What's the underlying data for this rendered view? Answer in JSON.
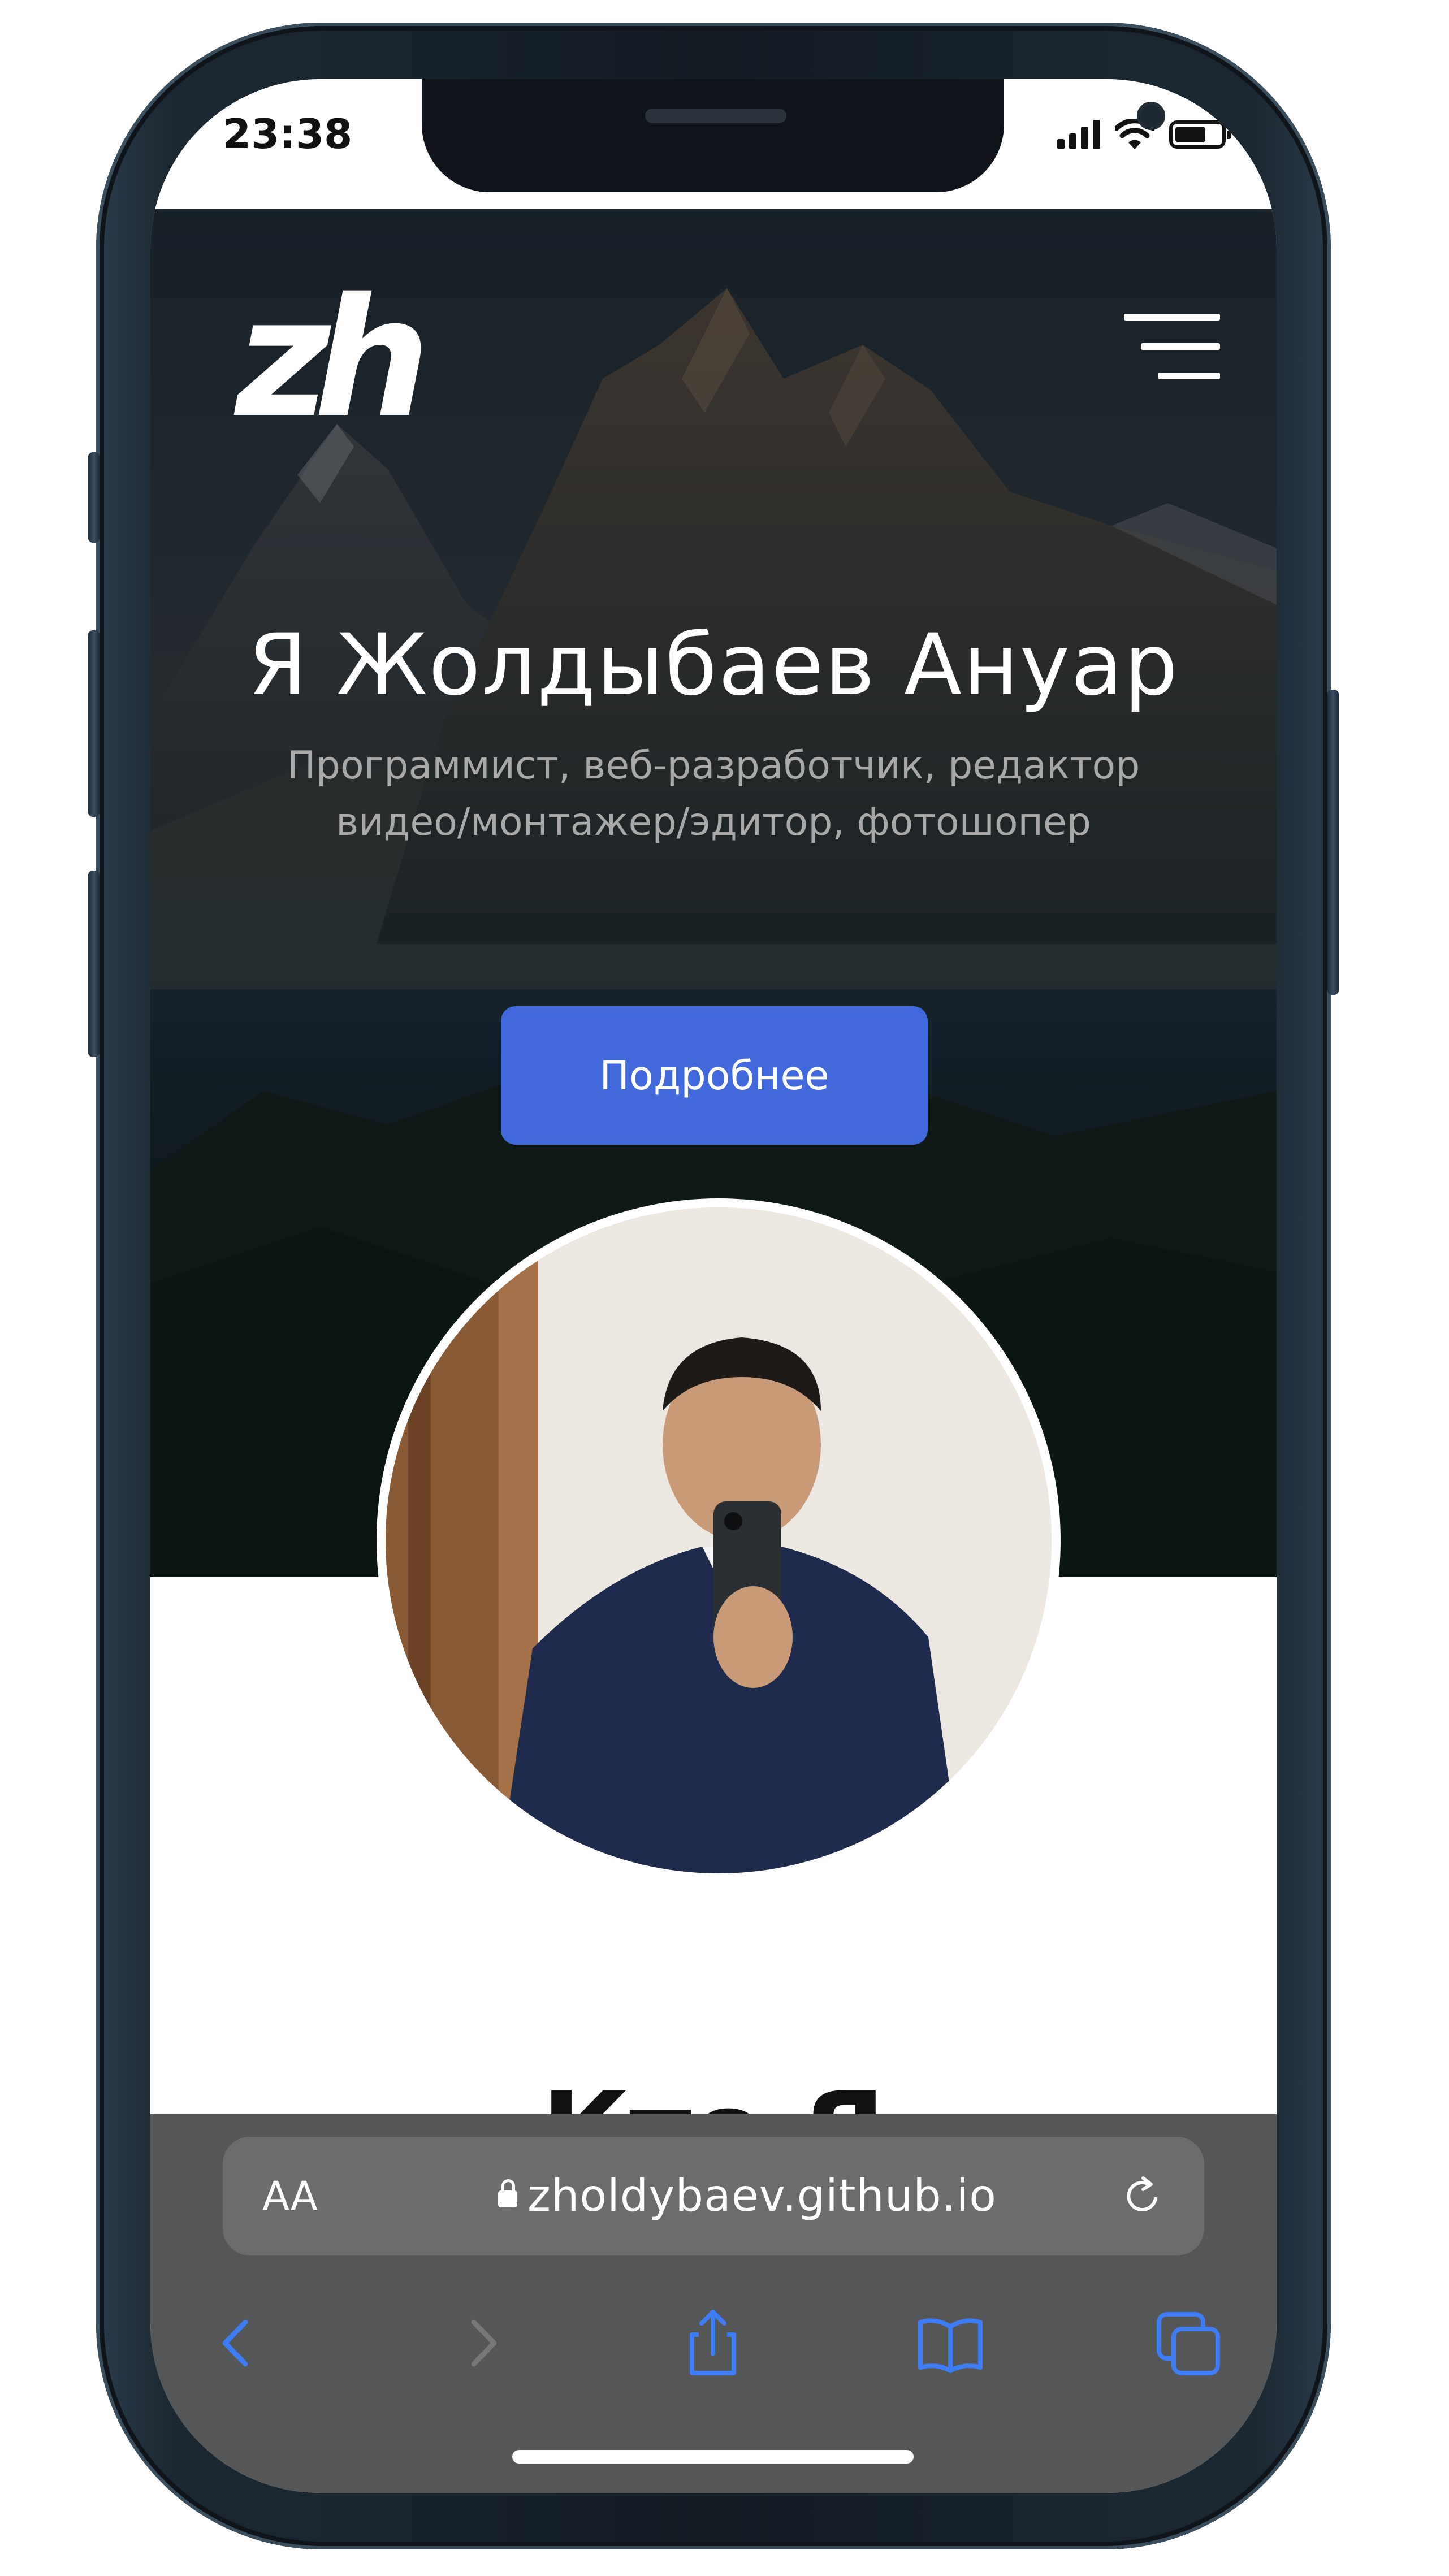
{
  "status_bar": {
    "time": "23:38"
  },
  "hero": {
    "logo": "zh",
    "title": "Я Жолдыбаев Ануар",
    "subtitle_line1": "Программист, веб-разработчик, редактор",
    "subtitle_line2": "видео/монтажер/эдитор, фотошопер",
    "button_label": "Подробнее"
  },
  "about": {
    "title_peek": "Кто Я"
  },
  "safari": {
    "text_size_label": "AA",
    "url": "zholdybaev.github.io",
    "icons": [
      "lock-icon",
      "reload-icon",
      "back-icon",
      "forward-icon",
      "share-icon",
      "bookmarks-icon",
      "tabs-icon"
    ]
  },
  "colors": {
    "accent": "#4169dc",
    "toolbar_icon": "#3d7cf5",
    "toolbar_bg": "#555657"
  }
}
